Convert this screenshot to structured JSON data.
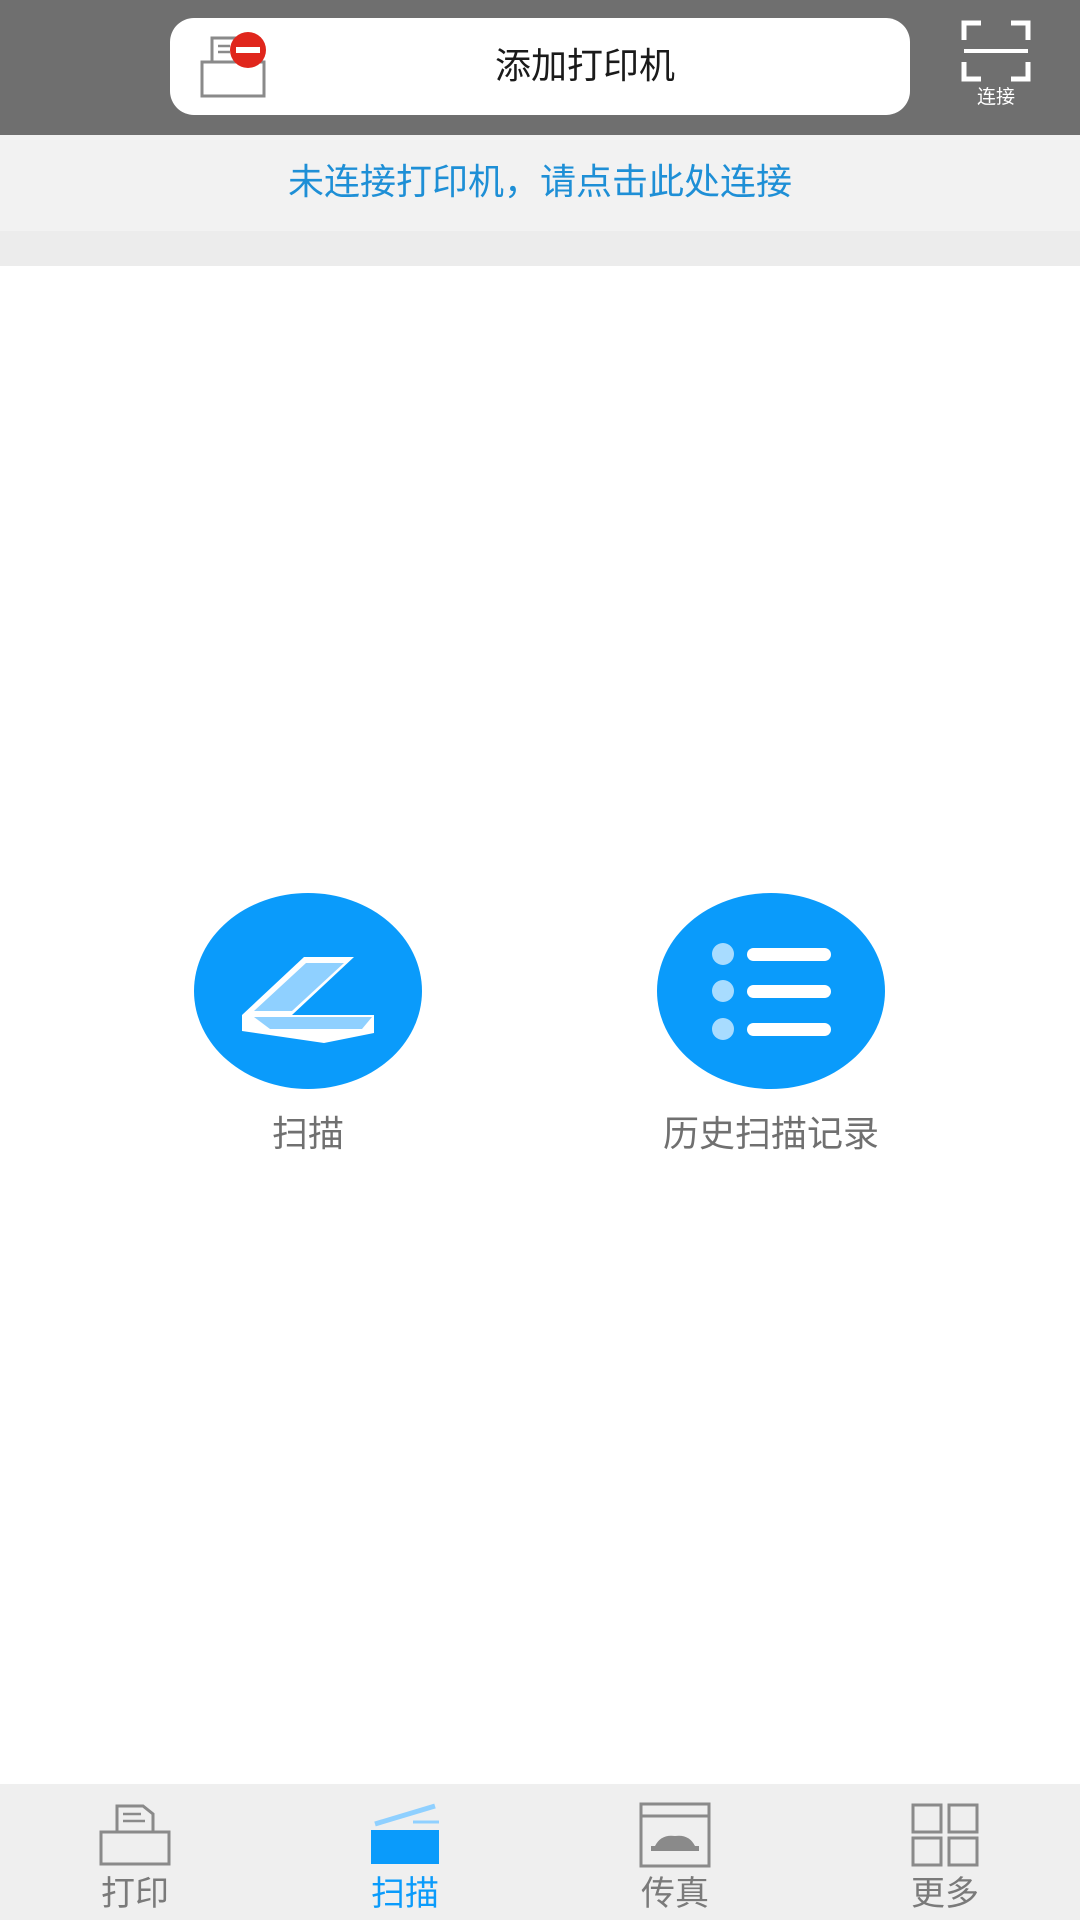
{
  "header": {
    "add_printer_title": "添加打印机",
    "connect_label": "连接"
  },
  "banner": {
    "status_text": "未连接打印机，请点击此处连接"
  },
  "actions": [
    {
      "label": "扫描",
      "icon": "scanner-icon"
    },
    {
      "label": "历史扫描记录",
      "icon": "list-icon"
    }
  ],
  "tabs": [
    {
      "label": "打印",
      "icon": "printer-icon",
      "active": false
    },
    {
      "label": "扫描",
      "icon": "scanner-icon",
      "active": true
    },
    {
      "label": "传真",
      "icon": "fax-icon",
      "active": false
    },
    {
      "label": "更多",
      "icon": "grid-icon",
      "active": false
    }
  ],
  "colors": {
    "header_bg": "#6f6f6f",
    "accent": "#0a9bfb",
    "banner_text": "#1e8fd6",
    "error_badge": "#e0261c",
    "tab_inactive": "#7a7a7a"
  }
}
